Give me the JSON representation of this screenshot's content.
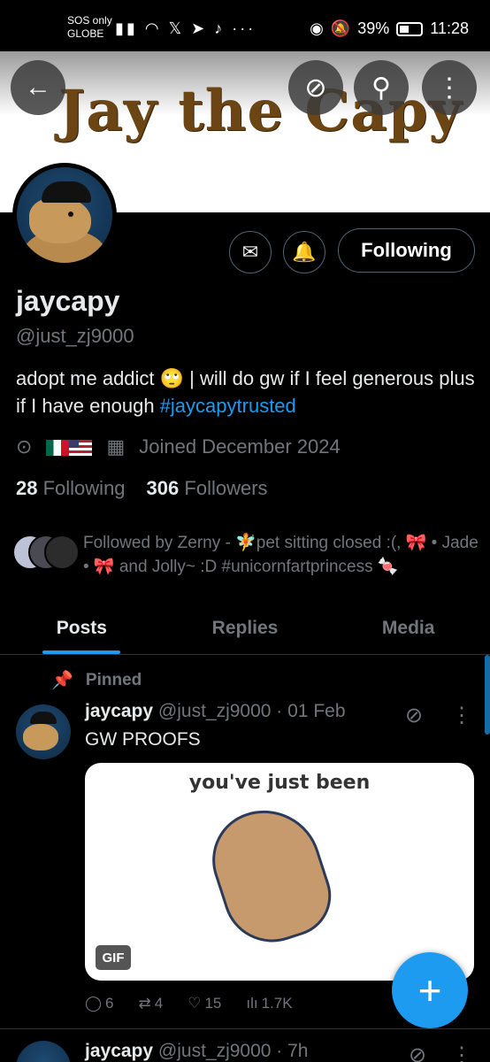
{
  "status_bar": {
    "carrier_line1": "SOS only",
    "carrier_line2": "GLOBE",
    "battery": "39%",
    "time": "11:28"
  },
  "banner": {
    "title": "Jay the Capy"
  },
  "profile": {
    "name": "jaycapy",
    "handle": "@just_zj9000",
    "bio_text": "adopt me addict 🙄 | will do gw if I feel generous plus if I have enough ",
    "bio_hashtag": "#jaycapytrusted",
    "joined": "Joined December 2024",
    "following_count": "28",
    "following_label": "Following",
    "followers_count": "306",
    "followers_label": "Followers",
    "following_button": "Following",
    "followed_by": "Followed by Zerny - 🧚pet sitting closed :(, 🎀 • Jade • 🎀 and Jolly~ :D #unicornfartprincess 🍬"
  },
  "tabs": [
    "Posts",
    "Replies",
    "Media"
  ],
  "pinned_label": "Pinned",
  "post": {
    "name": "jaycapy",
    "handle_time": "@just_zj9000 · 01 Feb",
    "text": "GW PROOFS",
    "media_caption": "you've just been",
    "gif_badge": "GIF",
    "replies": "6",
    "reposts": "4",
    "likes": "15",
    "views": "1.7K"
  },
  "next_post": {
    "name": "jaycapy",
    "handle_time": "@just_zj9000 · 7h"
  },
  "colors": {
    "accent": "#1d9bf0",
    "background": "#000000",
    "muted": "#71767b",
    "banner_text": "#6b4514"
  }
}
